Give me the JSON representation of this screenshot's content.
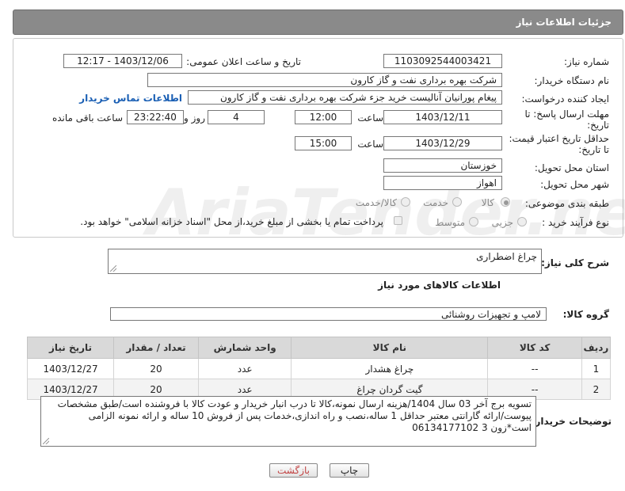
{
  "header": {
    "title": "جزئیات اطلاعات نیاز"
  },
  "form": {
    "need_number": {
      "label": "شماره نیاز:",
      "value": "1103092544003421"
    },
    "announce_datetime": {
      "label": "تاریخ و ساعت اعلان عمومی:",
      "value": "1403/12/06 - 12:17"
    },
    "buyer_org": {
      "label": "نام دستگاه خریدار:",
      "value": "شرکت بهره برداری نفت و گاز کارون"
    },
    "requester": {
      "label": "ایجاد کننده درخواست:",
      "value": "پیغام پورانیان آنالیست خرید جزء شرکت بهره برداری نفت و گاز کارون",
      "contact_link": "اطلاعات تماس خریدار"
    },
    "reply_deadline": {
      "label": "مهلت ارسال پاسخ: تا تاریخ:",
      "date": "1403/12/11",
      "time_label": "ساعت",
      "time": "12:00",
      "days": "4",
      "days_label": "روز و",
      "remaining": "23:22:40",
      "remaining_label": "ساعت باقی مانده"
    },
    "price_validity": {
      "label": "حداقل تاریخ اعتبار قیمت: تا تاریخ:",
      "date": "1403/12/29",
      "time_label": "ساعت",
      "time": "15:00"
    },
    "province": {
      "label": "استان محل تحویل:",
      "value": "خوزستان"
    },
    "city": {
      "label": "شهر محل تحویل:",
      "value": "اهواز"
    },
    "category": {
      "label": "طبقه بندی موضوعی:",
      "options": [
        "کالا",
        "خدمت",
        "کالا/خدمت"
      ]
    },
    "process": {
      "label": "نوع فرآیند خرید :",
      "options": [
        "جزیی",
        "متوسط"
      ],
      "payment_note": "پرداخت تمام یا بخشی از مبلغ خرید،از محل \"اسناد خزانه اسلامی\" خواهد بود."
    }
  },
  "summary": {
    "label": "شرح کلی نیاز:",
    "value": "چراغ اضطراری"
  },
  "items_section": {
    "title": "اطلاعات کالاهای مورد نیاز",
    "group_label": "گروه کالا:",
    "group_value": "لامپ و تجهیزات روشنائی",
    "columns": [
      "ردیف",
      "کد کالا",
      "نام کالا",
      "واحد شمارش",
      "تعداد / مقدار",
      "تاریخ نیاز"
    ],
    "rows": [
      [
        "1",
        "--",
        "چراغ هشدار",
        "عدد",
        "20",
        "1403/12/27"
      ],
      [
        "2",
        "--",
        "گیت گردان چراغ",
        "عدد",
        "20",
        "1403/12/27"
      ]
    ]
  },
  "buyer_notes": {
    "label": "توضیحات خریدار:",
    "value": "تسویه برج آخر 03 سال 1404/هزینه ارسال نمونه،کالا تا درب انبار خریدار و عودت کالا با فروشنده است/طبق مشخصات پیوست/ارائه گارانتی معتبر حداقل 1 ساله،نصب و راه اندازی،خدمات پس از فروش 10 ساله و ارائه نمونه الزامی است*زون 3 06134177102"
  },
  "buttons": {
    "print": "چاپ",
    "back": "بازگشت"
  },
  "watermark": "AriaTender.neT"
}
